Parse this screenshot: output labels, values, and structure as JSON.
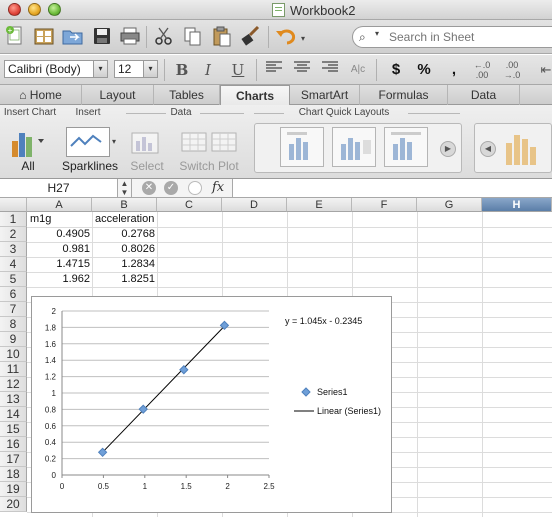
{
  "window": {
    "title": "Workbook2"
  },
  "toolbar": {
    "search_placeholder": "Search in Sheet",
    "icons": [
      "new-icon",
      "templates-icon",
      "open-icon",
      "save-icon",
      "print-icon",
      "cut-icon",
      "copy-icon",
      "paste-icon",
      "format-brush-icon",
      "undo-icon"
    ]
  },
  "format": {
    "font_name": "Calibri (Body)",
    "font_size": "12",
    "bold": "B",
    "italic": "I",
    "underline": "U",
    "currency": "$",
    "percent": "%",
    "comma": ","
  },
  "ribbon_tabs": [
    {
      "label": "Home",
      "active": false
    },
    {
      "label": "Layout",
      "active": false
    },
    {
      "label": "Tables",
      "active": false
    },
    {
      "label": "Charts",
      "active": true
    },
    {
      "label": "SmartArt",
      "active": false
    },
    {
      "label": "Formulas",
      "active": false
    },
    {
      "label": "Data",
      "active": false
    }
  ],
  "ribbon": {
    "insert_chart_label": "Insert Chart",
    "insert_label": "Insert",
    "data_label": "Data",
    "quick_layouts_label": "Chart Quick Layouts",
    "all_label": "All",
    "sparklines_label": "Sparklines",
    "select_label": "Select",
    "switch_plot_label": "Switch Plot"
  },
  "formula_bar": {
    "name_box": "H27",
    "fx": "fx",
    "value": ""
  },
  "sheet": {
    "columns": [
      "A",
      "B",
      "C",
      "D",
      "E",
      "F",
      "G",
      "H"
    ],
    "selected_column": "H",
    "rows": [
      "1",
      "2",
      "3",
      "4",
      "5",
      "6",
      "7",
      "8",
      "9",
      "10",
      "11",
      "12",
      "13",
      "14",
      "15",
      "16",
      "17",
      "18",
      "19",
      "20"
    ],
    "cells": {
      "A1": "m1g",
      "B1": "acceleration",
      "A2": "0.4905",
      "B2": "0.2768",
      "A3": "0.981",
      "B3": "0.8026",
      "A4": "1.4715",
      "B4": "1.2834",
      "A5": "1.962",
      "B5": "1.8251"
    }
  },
  "chart_data": {
    "type": "scatter",
    "x": [
      0.4905,
      0.981,
      1.4715,
      1.962
    ],
    "series": [
      {
        "name": "Series1",
        "values": [
          0.2768,
          0.8026,
          1.2834,
          1.8251
        ],
        "color": "#4f81bd"
      }
    ],
    "trendline": {
      "name": "Linear (Series1)",
      "slope": 1.045,
      "intercept": -0.2345,
      "equation": "y = 1.045x - 0.2345",
      "color": "#000000"
    },
    "x_ticks": [
      "0",
      "0.5",
      "1",
      "1.5",
      "2",
      "2.5"
    ],
    "y_ticks": [
      "0",
      "0.2",
      "0.4",
      "0.6",
      "0.8",
      "1",
      "1.2",
      "1.4",
      "1.6",
      "1.8",
      "2"
    ],
    "xlim": [
      0,
      2.5
    ],
    "ylim": [
      0,
      2
    ],
    "grid": true,
    "legend": "right"
  }
}
